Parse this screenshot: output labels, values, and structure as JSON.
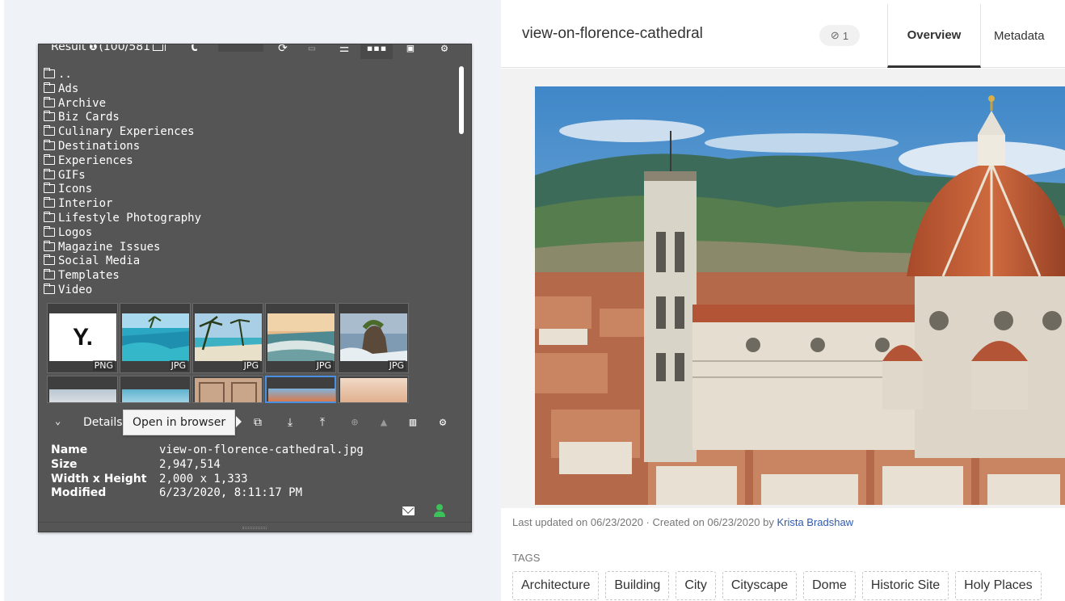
{
  "file_panel": {
    "result_label": "Result",
    "result_count": "(100/581",
    "toolbar_icons": [
      "refresh-icon",
      "rotate-icon",
      "copy-icon",
      "list-view-icon",
      "grid-view-icon",
      "card-view-icon",
      "settings-icon"
    ],
    "folders": [
      "..",
      "Ads",
      "Archive",
      "Biz Cards",
      "Culinary Experiences",
      "Destinations",
      "Experiences",
      "GIFs",
      "Icons",
      "Interior",
      "Lifestyle Photography",
      "Logos",
      "Magazine Issues",
      "Social Media",
      "Templates",
      "Video"
    ],
    "thumbnails_row1": [
      {
        "type": "PNG",
        "logo_text": "Y."
      },
      {
        "type": "JPG"
      },
      {
        "type": "JPG"
      },
      {
        "type": "JPG"
      },
      {
        "type": "JPG"
      }
    ],
    "details": {
      "title": "Details",
      "tooltip": "Open in browser",
      "toolbar_icons": [
        "external-link-icon",
        "download-icon",
        "upload-icon",
        "zoom-icon",
        "lock-icon",
        "trash-icon",
        "settings-icon"
      ],
      "rows": [
        {
          "key": "Name",
          "value": "view-on-florence-cathedral.jpg"
        },
        {
          "key": "Size",
          "value": "2,947,514"
        },
        {
          "key": "Width x Height",
          "value": "2,000 x 1,333"
        },
        {
          "key": "Modified",
          "value": "6/23/2020, 8:11:17 PM"
        }
      ]
    }
  },
  "asset": {
    "title": "view-on-florence-cathedral",
    "attachments": "1",
    "tabs": {
      "overview": "Overview",
      "metadata": "Metadata"
    },
    "updated_text": "Last updated on 06/23/2020 · Created on 06/23/2020 by",
    "author": "Krista Bradshaw",
    "tags_label": "TAGS",
    "tags": [
      "Architecture",
      "Building",
      "City",
      "Cityscape",
      "Dome",
      "Historic Site",
      "Holy Places"
    ]
  },
  "colors": {
    "panel_bg": "#555555",
    "selected_border": "#4a90e2",
    "link": "#2f5aae",
    "user_status": "#3cc25a"
  }
}
